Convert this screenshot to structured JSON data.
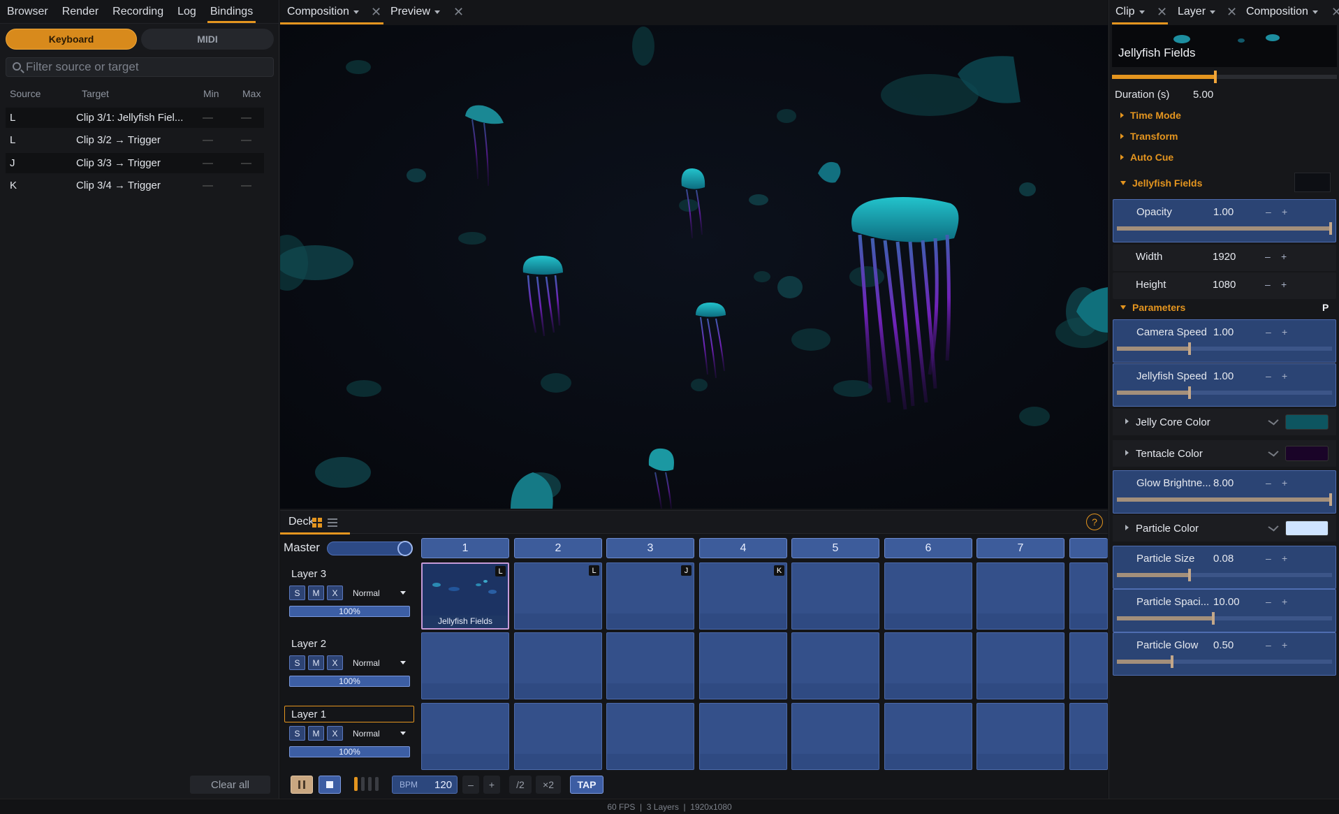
{
  "left_panel": {
    "tabs": [
      "Browser",
      "Render",
      "Recording",
      "Log",
      "Bindings"
    ],
    "active_tab": "Bindings",
    "segments": {
      "keyboard": "Keyboard",
      "midi": "MIDI"
    },
    "filter_placeholder": "Filter source or target",
    "columns": {
      "source": "Source",
      "target": "Target",
      "min": "Min",
      "max": "Max"
    },
    "rows": [
      {
        "source": "L",
        "target": "Clip 3/1: Jellyfish Fiel...",
        "min": "—",
        "max": "—"
      },
      {
        "source": "L",
        "target": "Clip 3/2 → Trigger",
        "min": "—",
        "max": "—"
      },
      {
        "source": "J",
        "target": "Clip 3/3 → Trigger",
        "min": "—",
        "max": "—"
      },
      {
        "source": "K",
        "target": "Clip 3/4 → Trigger",
        "min": "—",
        "max": "—"
      }
    ],
    "clear_all": "Clear all"
  },
  "center": {
    "tabs": [
      "Composition",
      "Preview"
    ],
    "deck_label": "Deck",
    "help": "?",
    "master_label": "Master",
    "column_headers": [
      "1",
      "2",
      "3",
      "4",
      "5",
      "6",
      "7"
    ],
    "layers": [
      {
        "name": "Layer 3",
        "s": "S",
        "m": "M",
        "x": "X",
        "blend": "Normal",
        "opacity": "100%"
      },
      {
        "name": "Layer 2",
        "s": "S",
        "m": "M",
        "x": "X",
        "blend": "Normal",
        "opacity": "100%"
      },
      {
        "name": "Layer 1",
        "s": "S",
        "m": "M",
        "x": "X",
        "blend": "Normal",
        "opacity": "100%"
      }
    ],
    "clip_keys": {
      "c1": "L",
      "c2": "L",
      "c3": "J",
      "c4": "K"
    },
    "clip_name": "Jellyfish Fields",
    "transport": {
      "bpm_label": "BPM",
      "bpm_value": "120",
      "minus": "–",
      "plus": "+",
      "half": "/2",
      "double": "×2",
      "tap": "TAP"
    }
  },
  "right_panel": {
    "tabs": [
      "Clip",
      "Layer",
      "Composition"
    ],
    "clip_title": "Jellyfish Fields",
    "duration_label": "Duration (s)",
    "duration_value": "5.00",
    "sections": {
      "time_mode": "Time Mode",
      "transform": "Transform",
      "auto_cue": "Auto Cue",
      "jellyfish_fields": "Jellyfish Fields",
      "parameters": "Parameters",
      "p_badge": "P"
    },
    "params": {
      "opacity": {
        "name": "Opacity",
        "value": "1.00",
        "level": 1.0
      },
      "width": {
        "name": "Width",
        "value": "1920"
      },
      "height": {
        "name": "Height",
        "value": "1080"
      },
      "camera_speed": {
        "name": "Camera Speed",
        "value": "1.00",
        "level": 0.33
      },
      "jellyfish_speed": {
        "name": "Jellyfish Speed",
        "value": "1.00",
        "level": 0.33
      },
      "jelly_core_color": {
        "name": "Jelly Core Color",
        "color": "#0d5560"
      },
      "tentacle_color": {
        "name": "Tentacle Color",
        "color": "#1a0428"
      },
      "glow_brightness": {
        "name": "Glow Brightne...",
        "value": "8.00",
        "level": 1.0
      },
      "particle_color": {
        "name": "Particle Color",
        "color": "#cfe4ff"
      },
      "particle_size": {
        "name": "Particle Size",
        "value": "0.08",
        "level": 0.33
      },
      "particle_spacing": {
        "name": "Particle Spaci...",
        "value": "10.00",
        "level": 0.44
      },
      "particle_glow": {
        "name": "Particle Glow",
        "value": "0.50",
        "level": 0.25
      }
    },
    "minus": "–",
    "plus": "+"
  },
  "status_bar": "60 FPS  |  3 Layers  |  1920x1080",
  "colors": {
    "accent": "#e4951f",
    "cell": "#34508a",
    "cell_border": "#4c6aaa",
    "viewport_bg": "#0a0d14",
    "jelly_cyan": "#22b5c4",
    "tentacle_purple": "#6a1fa8"
  }
}
